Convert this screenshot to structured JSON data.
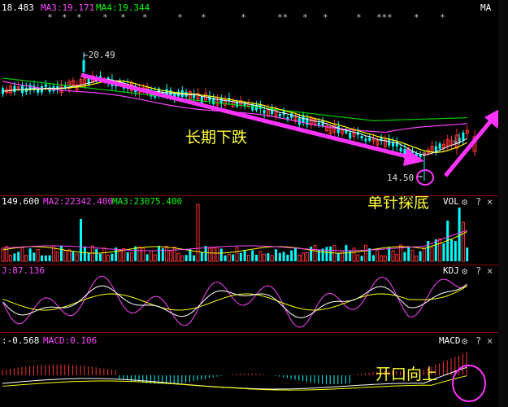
{
  "price_panel": {
    "ma_labels": [
      {
        "text": "18.483",
        "color": "#ffffff"
      },
      {
        "text": "MA3:19.171",
        "color": "#ff44ff"
      },
      {
        "text": "MA4:19.344",
        "color": "#00ff00"
      }
    ],
    "ma_button": "MA",
    "markers": [
      "*",
      "*",
      "*",
      "*",
      "*",
      "*",
      "*",
      "*",
      "*",
      "**",
      "*",
      "*",
      "*",
      "***",
      "*",
      "*"
    ],
    "high_label": "←20.49",
    "low_label": "14.50",
    "annotation_trend": "长期下跌",
    "annotation_bottom": "单针探底"
  },
  "volume_panel": {
    "labels": [
      {
        "text": "149.600",
        "color": "#ffffff"
      },
      {
        "text": "MA2:22342.400",
        "color": "#ff44ff"
      },
      {
        "text": "MA3:23075.400",
        "color": "#00ff00"
      }
    ],
    "indicator": "VOL"
  },
  "kdj_panel": {
    "labels": [
      {
        "text": "J:87.136",
        "color": "#ff44ff"
      }
    ],
    "indicator": "KDJ"
  },
  "macd_panel": {
    "labels": [
      {
        "text": ":-0.568",
        "color": "#ffffff"
      },
      {
        "text": "MACD:0.106",
        "color": "#ff44ff"
      }
    ],
    "indicator": "MACD",
    "annotation": "开口向上"
  },
  "icons": [
    "gear-icon",
    "help-icon",
    "close-icon"
  ],
  "colors": {
    "up": "#ff3333",
    "down": "#00ffff",
    "ma_white": "#ffffff",
    "ma_yellow": "#ffff00",
    "ma_magenta": "#ff44ff",
    "ma_green": "#00cc00",
    "annotation": "#ff33ff"
  }
}
